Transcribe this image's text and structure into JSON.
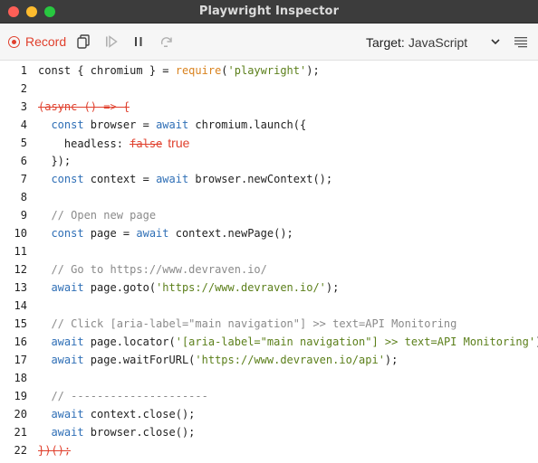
{
  "window": {
    "title": "Playwright Inspector"
  },
  "toolbar": {
    "record_label": "Record",
    "target_label": "Target:",
    "target_value": "JavaScript"
  },
  "colors": {
    "titlebar": "#3c3c3c",
    "record_accent": "#e0402d",
    "keyword": "#2f6fb6",
    "string": "#5b7f1a",
    "comment": "#8a8a8a"
  },
  "icons": [
    "record-icon",
    "copy-icon",
    "resume-icon",
    "pause-icon",
    "step-over-icon",
    "chevron-down-icon",
    "settings-icon"
  ],
  "editor": {
    "lines": [
      {
        "n": "1",
        "segs": [
          {
            "t": "const { chromium } = "
          },
          {
            "t": "require",
            "c": "kw2"
          },
          {
            "t": "("
          },
          {
            "t": "'playwright'",
            "c": "str"
          },
          {
            "t": ");"
          }
        ]
      },
      {
        "n": "2",
        "segs": []
      },
      {
        "n": "3",
        "segs": [
          {
            "t": "(async () => {",
            "c": "strike"
          }
        ]
      },
      {
        "n": "4",
        "segs": [
          {
            "t": "  "
          },
          {
            "t": "const",
            "c": "kw"
          },
          {
            "t": " browser = "
          },
          {
            "t": "await",
            "c": "kw"
          },
          {
            "t": " chromium.launch({"
          }
        ]
      },
      {
        "n": "5",
        "segs": [
          {
            "t": "    headless: "
          },
          {
            "t": "false",
            "c": "strike"
          },
          {
            "t": "true",
            "c": "ins"
          }
        ]
      },
      {
        "n": "6",
        "segs": [
          {
            "t": "  });"
          }
        ]
      },
      {
        "n": "7",
        "segs": [
          {
            "t": "  "
          },
          {
            "t": "const",
            "c": "kw"
          },
          {
            "t": " context = "
          },
          {
            "t": "await",
            "c": "kw"
          },
          {
            "t": " browser.newContext();"
          }
        ]
      },
      {
        "n": "8",
        "segs": []
      },
      {
        "n": "9",
        "segs": [
          {
            "t": "  "
          },
          {
            "t": "// Open new page",
            "c": "cm"
          }
        ]
      },
      {
        "n": "10",
        "segs": [
          {
            "t": "  "
          },
          {
            "t": "const",
            "c": "kw"
          },
          {
            "t": " page = "
          },
          {
            "t": "await",
            "c": "kw"
          },
          {
            "t": " context.newPage();"
          }
        ]
      },
      {
        "n": "11",
        "segs": []
      },
      {
        "n": "12",
        "segs": [
          {
            "t": "  "
          },
          {
            "t": "// Go to https://www.devraven.io/",
            "c": "cm"
          }
        ]
      },
      {
        "n": "13",
        "segs": [
          {
            "t": "  "
          },
          {
            "t": "await",
            "c": "kw"
          },
          {
            "t": " page.goto("
          },
          {
            "t": "'https://www.devraven.io/'",
            "c": "str"
          },
          {
            "t": ");"
          }
        ]
      },
      {
        "n": "14",
        "segs": []
      },
      {
        "n": "15",
        "segs": [
          {
            "t": "  "
          },
          {
            "t": "// Click [aria-label=\"main navigation\"] >> text=API Monitoring",
            "c": "cm"
          }
        ]
      },
      {
        "n": "16",
        "segs": [
          {
            "t": "  "
          },
          {
            "t": "await",
            "c": "kw"
          },
          {
            "t": " page.locator("
          },
          {
            "t": "'[aria-label=\"main navigation\"] >> text=API Monitoring'",
            "c": "str"
          },
          {
            "t": ")"
          }
        ]
      },
      {
        "n": "17",
        "segs": [
          {
            "t": "  "
          },
          {
            "t": "await",
            "c": "kw"
          },
          {
            "t": " page.waitForURL("
          },
          {
            "t": "'https://www.devraven.io/api'",
            "c": "str"
          },
          {
            "t": ");"
          }
        ]
      },
      {
        "n": "18",
        "segs": []
      },
      {
        "n": "19",
        "segs": [
          {
            "t": "  "
          },
          {
            "t": "// ---------------------",
            "c": "cm"
          }
        ]
      },
      {
        "n": "20",
        "segs": [
          {
            "t": "  "
          },
          {
            "t": "await",
            "c": "kw"
          },
          {
            "t": " context.close();"
          }
        ]
      },
      {
        "n": "21",
        "segs": [
          {
            "t": "  "
          },
          {
            "t": "await",
            "c": "kw"
          },
          {
            "t": " browser.close();"
          }
        ]
      },
      {
        "n": "22",
        "segs": [
          {
            "t": "})();",
            "c": "strike"
          }
        ]
      }
    ]
  }
}
